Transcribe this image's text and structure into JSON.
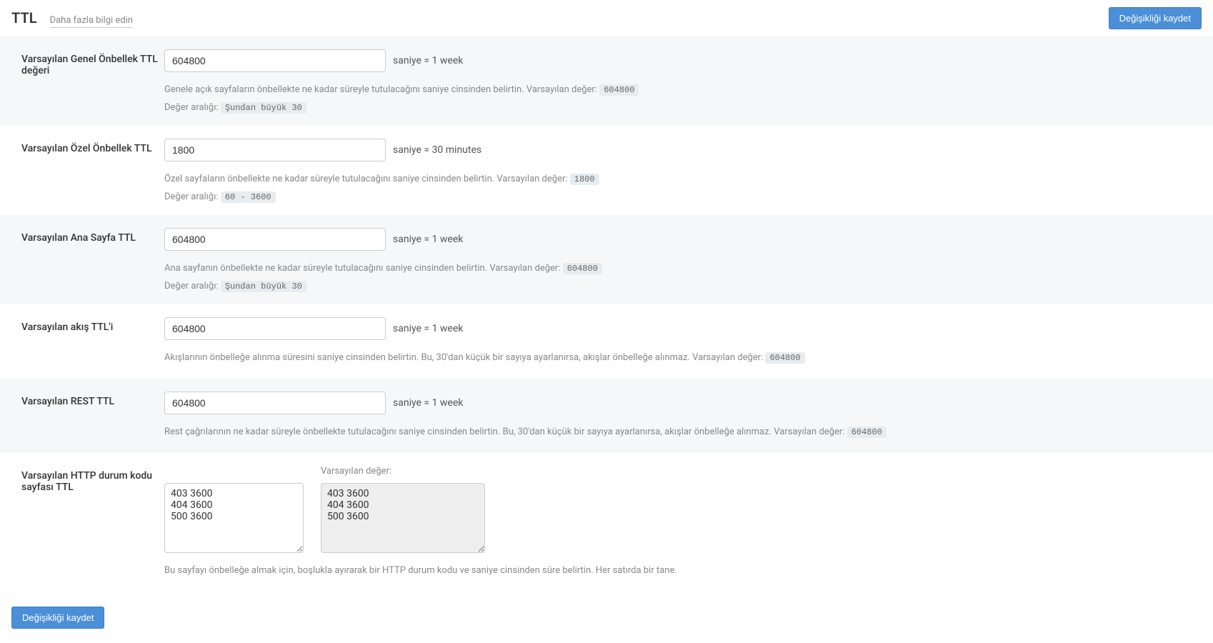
{
  "header": {
    "title": "TTL",
    "learn_more": "Daha fazla bilgi edin",
    "save_button": "Değişikliği kaydet"
  },
  "sections": {
    "public_ttl": {
      "label": "Varsayılan Genel Önbellek TTL değeri",
      "value": "604800",
      "suffix": "saniye = 1 week",
      "help": "Genele açık sayfaların önbellekte ne kadar süreyle tutulacağını saniye cinsinden belirtin. Varsayılan değer:",
      "default_value": "604800",
      "range_label": "Değer aralığı:",
      "range_value": "Şundan büyük 30"
    },
    "private_ttl": {
      "label": "Varsayılan Özel Önbellek TTL",
      "value": "1800",
      "suffix": "saniye = 30 minutes",
      "help": "Özel sayfaların önbellekte ne kadar süreyle tutulacağını saniye cinsinden belirtin. Varsayılan değer:",
      "default_value": "1800",
      "range_label": "Değer aralığı:",
      "range_value": "60 - 3600"
    },
    "homepage_ttl": {
      "label": "Varsayılan Ana Sayfa TTL",
      "value": "604800",
      "suffix": "saniye = 1 week",
      "help": "Ana sayfanın önbellekte ne kadar süreyle tutulacağını saniye cinsinden belirtin. Varsayılan değer:",
      "default_value": "604800",
      "range_label": "Değer aralığı:",
      "range_value": "Şundan büyük 30"
    },
    "feed_ttl": {
      "label": "Varsayılan akış TTL'i",
      "value": "604800",
      "suffix": "saniye = 1 week",
      "help": "Akışlarının önbelleğe alınma süresini saniye cinsinden belirtin. Bu, 30'dan küçük bir sayıya ayarlanırsa, akışlar önbelleğe alınmaz. Varsayılan değer:",
      "default_value": "604800"
    },
    "rest_ttl": {
      "label": "Varsayılan REST TTL",
      "value": "604800",
      "suffix": "saniye = 1 week",
      "help": "Rest çağrılarının ne kadar süreyle önbellekte tutulacağını saniye cinsinden belirtin. Bu, 30'dan küçük bir sayıya ayarlanırsa, akışlar önbelleğe alınmaz. Varsayılan değer:",
      "default_value": "604800"
    },
    "status_ttl": {
      "label": "Varsayılan HTTP durum kodu sayfası TTL",
      "value": "403 3600\n404 3600\n500 3600",
      "default_label": "Varsayılan değer:",
      "default_value": "403 3600\n404 3600\n500 3600",
      "help": "Bu sayfayı önbelleğe almak için, boşlukla ayırarak bir HTTP durum kodu ve saniye cinsinden süre belirtin. Her satırda bir tane."
    }
  },
  "footer": {
    "save_button": "Değişikliği kaydet"
  }
}
